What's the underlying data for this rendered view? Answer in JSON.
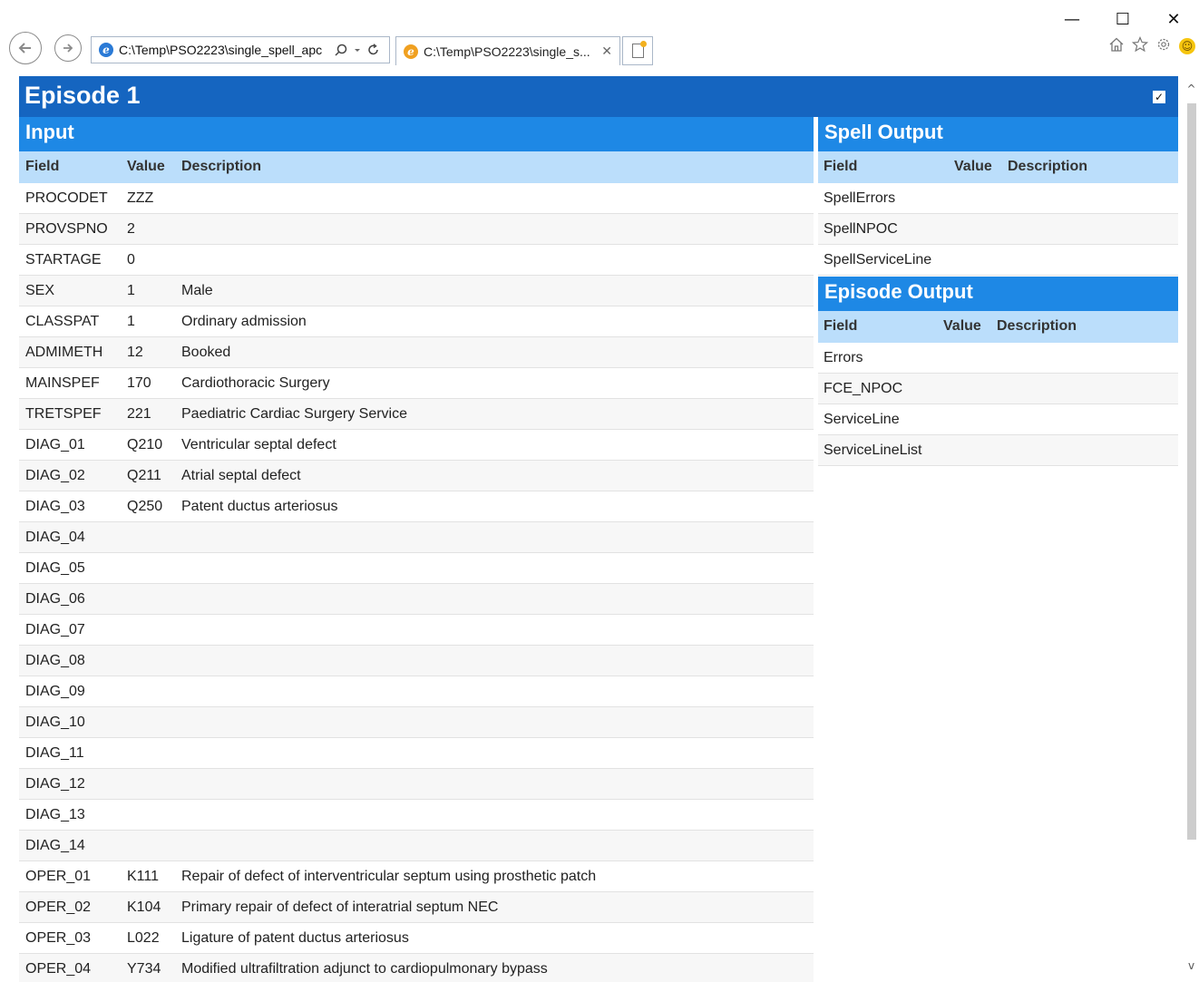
{
  "browser": {
    "address": "C:\\Temp\\PSO2223\\single_spell_apc",
    "tab_title": "C:\\Temp\\PSO2223\\single_s...",
    "window_controls": {
      "minimize": "—",
      "maximize": "☐",
      "close": "✕"
    },
    "toolbar_icons": [
      "home-icon",
      "star-icon",
      "gear-icon",
      "smiley-icon"
    ]
  },
  "episode": {
    "title": "Episode 1",
    "checked": true
  },
  "input": {
    "title": "Input",
    "columns": {
      "field": "Field",
      "value": "Value",
      "description": "Description"
    },
    "rows": [
      {
        "field": "PROCODET",
        "value": "ZZZ",
        "description": ""
      },
      {
        "field": "PROVSPNO",
        "value": "2",
        "description": ""
      },
      {
        "field": "STARTAGE",
        "value": "0",
        "description": ""
      },
      {
        "field": "SEX",
        "value": "1",
        "description": "Male"
      },
      {
        "field": "CLASSPAT",
        "value": "1",
        "description": "Ordinary admission"
      },
      {
        "field": "ADMIMETH",
        "value": "12",
        "description": "Booked"
      },
      {
        "field": "MAINSPEF",
        "value": "170",
        "description": "Cardiothoracic Surgery"
      },
      {
        "field": "TRETSPEF",
        "value": "221",
        "description": "Paediatric Cardiac Surgery Service"
      },
      {
        "field": "DIAG_01",
        "value": "Q210",
        "description": "Ventricular septal defect"
      },
      {
        "field": "DIAG_02",
        "value": "Q211",
        "description": "Atrial septal defect"
      },
      {
        "field": "DIAG_03",
        "value": "Q250",
        "description": "Patent ductus arteriosus"
      },
      {
        "field": "DIAG_04",
        "value": "",
        "description": ""
      },
      {
        "field": "DIAG_05",
        "value": "",
        "description": ""
      },
      {
        "field": "DIAG_06",
        "value": "",
        "description": ""
      },
      {
        "field": "DIAG_07",
        "value": "",
        "description": ""
      },
      {
        "field": "DIAG_08",
        "value": "",
        "description": ""
      },
      {
        "field": "DIAG_09",
        "value": "",
        "description": ""
      },
      {
        "field": "DIAG_10",
        "value": "",
        "description": ""
      },
      {
        "field": "DIAG_11",
        "value": "",
        "description": ""
      },
      {
        "field": "DIAG_12",
        "value": "",
        "description": ""
      },
      {
        "field": "DIAG_13",
        "value": "",
        "description": ""
      },
      {
        "field": "DIAG_14",
        "value": "",
        "description": ""
      },
      {
        "field": "OPER_01",
        "value": "K111",
        "description": "Repair of defect of interventricular septum using prosthetic patch"
      },
      {
        "field": "OPER_02",
        "value": "K104",
        "description": "Primary repair of defect of interatrial septum NEC"
      },
      {
        "field": "OPER_03",
        "value": "L022",
        "description": "Ligature of patent ductus arteriosus"
      },
      {
        "field": "OPER_04",
        "value": "Y734",
        "description": "Modified ultrafiltration adjunct to cardiopulmonary bypass"
      }
    ]
  },
  "spell_output": {
    "title": "Spell Output",
    "columns": {
      "field": "Field",
      "value": "Value",
      "description": "Description"
    },
    "rows": [
      {
        "field": "SpellErrors",
        "value": "",
        "description": ""
      },
      {
        "field": "SpellNPOC",
        "value": "",
        "description": ""
      },
      {
        "field": "SpellServiceLine",
        "value": "",
        "description": ""
      }
    ]
  },
  "episode_output": {
    "title": "Episode Output",
    "columns": {
      "field": "Field",
      "value": "Value",
      "description": "Description"
    },
    "rows": [
      {
        "field": "Errors",
        "value": "",
        "description": ""
      },
      {
        "field": "FCE_NPOC",
        "value": "",
        "description": ""
      },
      {
        "field": "ServiceLine",
        "value": "",
        "description": ""
      },
      {
        "field": "ServiceLineList",
        "value": "",
        "description": ""
      }
    ]
  }
}
